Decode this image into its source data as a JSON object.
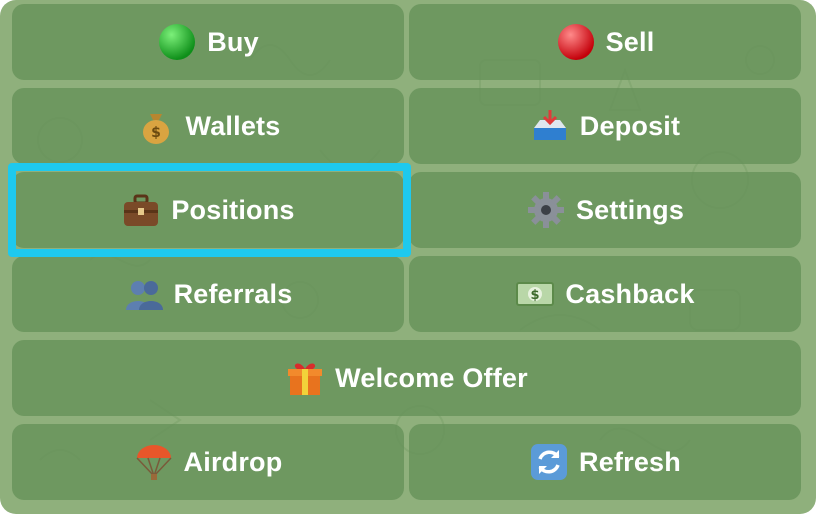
{
  "menu": {
    "buy_label": "Buy",
    "sell_label": "Sell",
    "wallets_label": "Wallets",
    "deposit_label": "Deposit",
    "positions_label": "Positions",
    "settings_label": "Settings",
    "referrals_label": "Referrals",
    "cashback_label": "Cashback",
    "welcome_offer_label": "Welcome Offer",
    "airdrop_label": "Airdrop",
    "refresh_label": "Refresh"
  },
  "icons": {
    "buy": "green-circle-icon",
    "sell": "red-circle-icon",
    "wallets": "money-bag-icon",
    "deposit": "inbox-tray-icon",
    "positions": "briefcase-icon",
    "settings": "gear-icon",
    "referrals": "busts-icon",
    "cashback": "dollar-banknote-icon",
    "welcome_offer": "gift-icon",
    "airdrop": "parachute-icon",
    "refresh": "refresh-icon"
  },
  "colors": {
    "background": "#8fb07c",
    "button": "#66925a",
    "highlight": "#1ec9ee"
  }
}
